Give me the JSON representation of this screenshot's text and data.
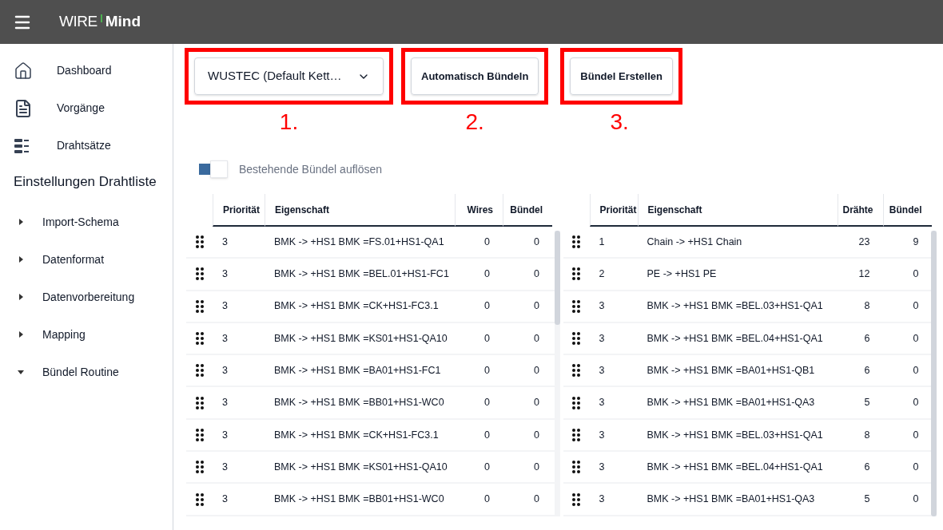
{
  "app_bar": {
    "logo_left": "WIRE",
    "logo_right": "Mind"
  },
  "sidebar": {
    "items": [
      {
        "kind": "home",
        "label": "Dashboard"
      },
      {
        "kind": "document",
        "label": "Vorgänge"
      },
      {
        "kind": "list",
        "label": "Drahtsätze"
      }
    ],
    "section_title": "Einstellungen Drahtliste",
    "settings": [
      {
        "label": "Import-Schema",
        "expanded": false
      },
      {
        "label": "Datenformat",
        "expanded": false
      },
      {
        "label": "Datenvorbereitung",
        "expanded": false
      },
      {
        "label": "Mapping",
        "expanded": false
      },
      {
        "label": "Bündel Routine",
        "expanded": true
      }
    ]
  },
  "toolbar": {
    "dropdown": {
      "value": "WUSTEC (Default Kett…",
      "step": "1."
    },
    "buttons": [
      {
        "label": "Automatisch Bündeln",
        "step": "2."
      },
      {
        "label": "Bündel Erstellen",
        "step": "3."
      }
    ]
  },
  "toggle": {
    "label": "Bestehende Bündel auflösen",
    "on": true
  },
  "tables": [
    {
      "columns": [
        "Priorität",
        "Eigenschaft",
        "Wires",
        "Bündel"
      ],
      "rows": [
        [
          "3",
          "BMK -> +HS1 BMK =FS.01+HS1-QA1",
          "0",
          "0"
        ],
        [
          "3",
          "BMK -> +HS1 BMK =BEL.01+HS1-FC1",
          "0",
          "0"
        ],
        [
          "3",
          "BMK -> +HS1 BMK =CK+HS1-FC3.1",
          "0",
          "0"
        ],
        [
          "3",
          "BMK -> +HS1 BMK =KS01+HS1-QA10",
          "0",
          "0"
        ],
        [
          "3",
          "BMK -> +HS1 BMK =BA01+HS1-FC1",
          "0",
          "0"
        ],
        [
          "3",
          "BMK -> +HS1 BMK =BB01+HS1-WC0",
          "0",
          "0"
        ],
        [
          "3",
          "BMK -> +HS1 BMK =CK+HS1-FC3.1",
          "0",
          "0"
        ],
        [
          "3",
          "BMK -> +HS1 BMK =KS01+HS1-QA10",
          "0",
          "0"
        ],
        [
          "3",
          "BMK -> +HS1 BMK =BB01+HS1-WC0",
          "0",
          "0"
        ]
      ]
    },
    {
      "columns": [
        "Priorität",
        "Eigenschaft",
        "Drähte",
        "Bündel"
      ],
      "rows": [
        [
          "1",
          "Chain -> +HS1 Chain",
          "23",
          "9"
        ],
        [
          "2",
          "PE -> +HS1 PE",
          "12",
          "0"
        ],
        [
          "3",
          "BMK -> +HS1 BMK =BEL.03+HS1-QA1",
          "8",
          "0"
        ],
        [
          "3",
          "BMK -> +HS1 BMK =BEL.04+HS1-QA1",
          "6",
          "0"
        ],
        [
          "3",
          "BMK -> +HS1 BMK =BA01+HS1-QB1",
          "6",
          "0"
        ],
        [
          "3",
          "BMK -> +HS1 BMK =BA01+HS1-QA3",
          "5",
          "0"
        ],
        [
          "3",
          "BMK -> +HS1 BMK =BEL.03+HS1-QA1",
          "8",
          "0"
        ],
        [
          "3",
          "BMK -> +HS1 BMK =BEL.04+HS1-QA1",
          "6",
          "0"
        ],
        [
          "3",
          "BMK -> +HS1 BMK =BA01+HS1-QA3",
          "5",
          "0"
        ]
      ]
    }
  ]
}
